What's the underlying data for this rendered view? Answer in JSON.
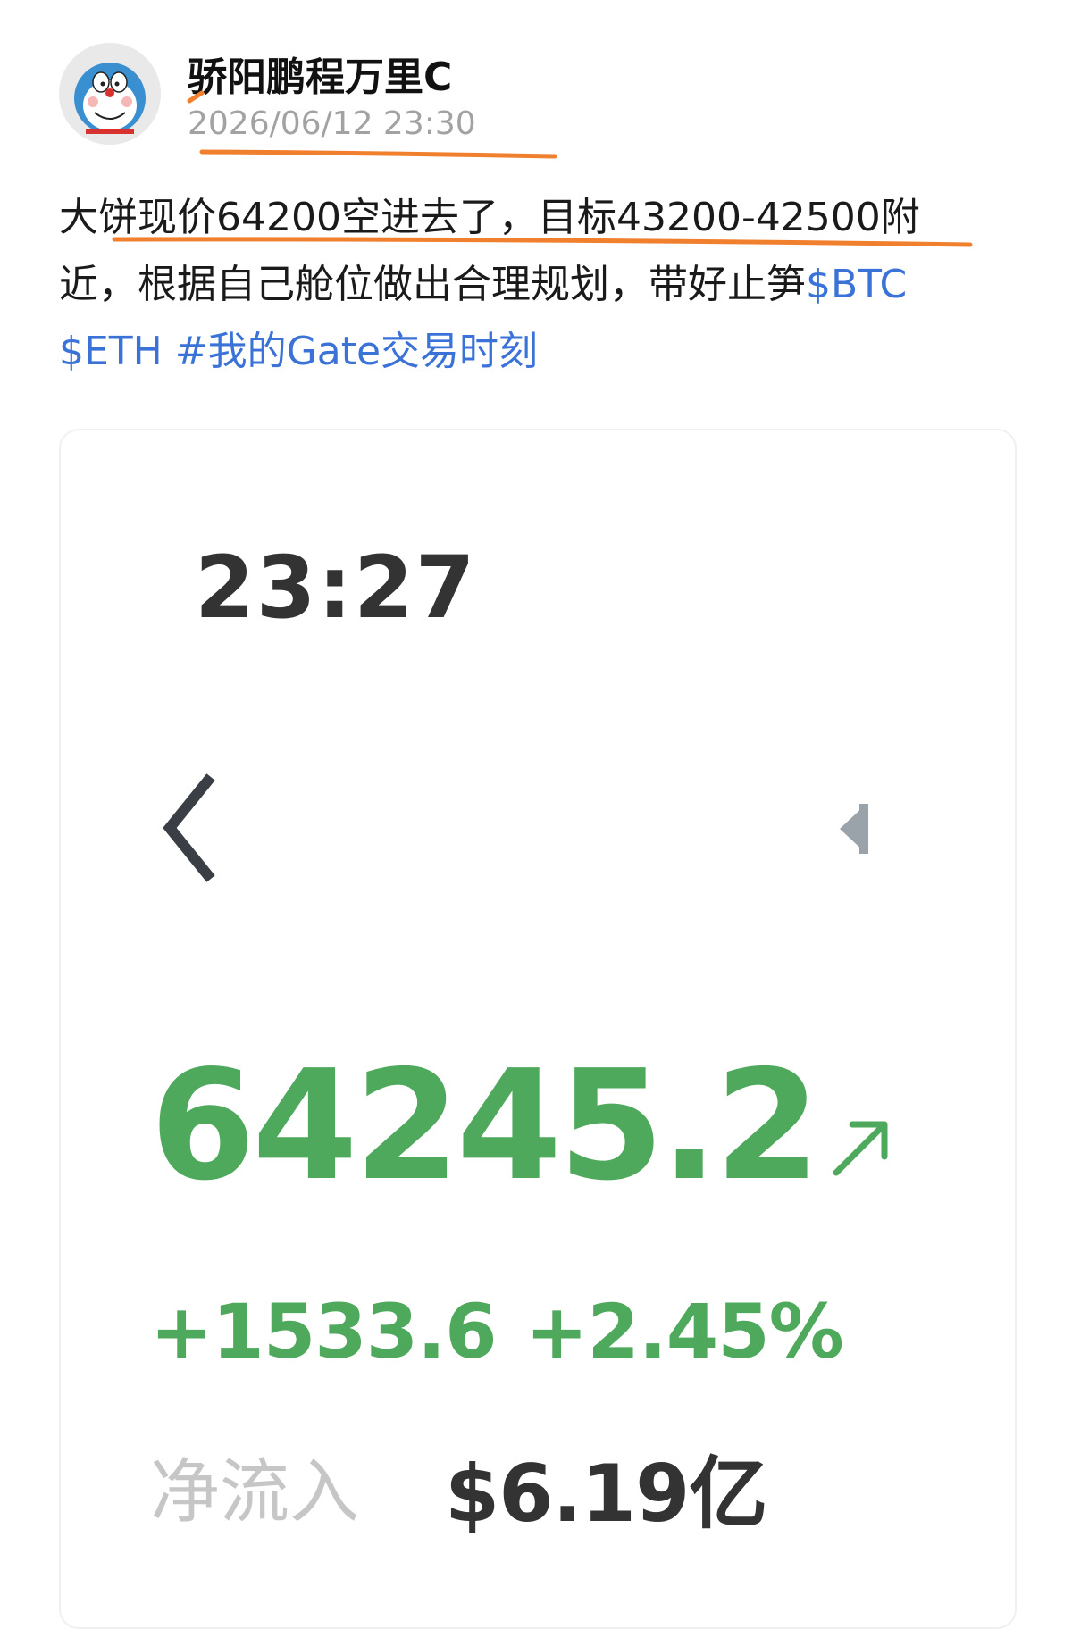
{
  "post": {
    "author": "骄阳鹏程万里C",
    "timestamp": "2026/06/12 23:30",
    "avatar_icon": "doraemon-avatar",
    "body": {
      "line1": "大饼现价64200空进去了，目标43200-42500附",
      "line2_text": "近，根据自己舱位做出合理规划，带好止笋",
      "tags": [
        "$BTC",
        "$ETH",
        "#我的Gate交易时刻"
      ]
    },
    "markup_color": "#f07f2e",
    "tag_color": "#3a72d8"
  },
  "card": {
    "time": "23:27",
    "back_icon": "chevron-left-icon",
    "collapse_icon": "triangle-left-icon",
    "price": "64245.2",
    "trend_icon": "arrow-up-right-icon",
    "change_abs": "+1533.6",
    "change_pct": "+2.45%",
    "net_inflow_label": "净流入",
    "net_inflow_value": "$6.19亿",
    "up_color": "#4ea95c"
  }
}
